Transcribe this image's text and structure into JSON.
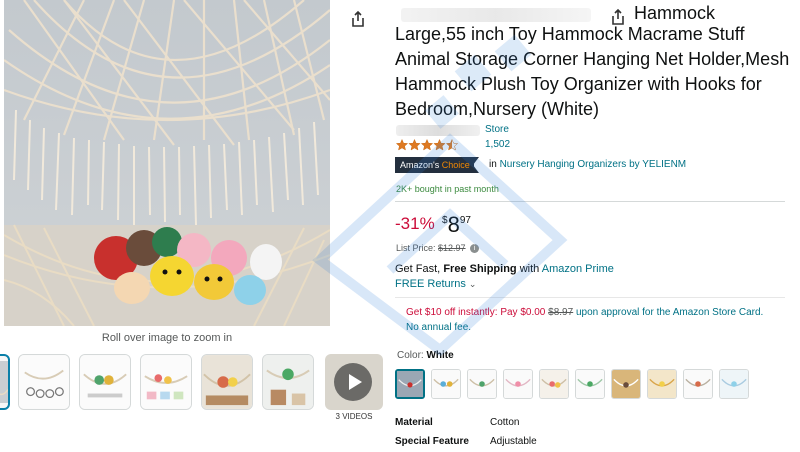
{
  "product": {
    "title_fragment_top": "Hammock",
    "title": "Large,55 inch Toy Hammock Macrame Stuff Animal Storage Corner Hanging Net Holder,Mesh Hammock Plush Toy Organizer with Hooks for Bedroom,Nursery (White)",
    "store_link": "Store",
    "rating_count": "1,502",
    "badge_prefix": "Amazon's",
    "badge_accent": "Choice",
    "badge_in": "in",
    "badge_category": "Nursery Hanging Organizers by YELIENM",
    "bought_past_month": "2K+ bought in past month"
  },
  "pricing": {
    "discount": "-31%",
    "currency": "$",
    "price_whole": "8",
    "price_fraction": "97",
    "list_price_label": "List Price:",
    "list_price_value": "$12.97",
    "info_icon": "i"
  },
  "delivery": {
    "shipping_prefix": "Get Fast,",
    "shipping_bold": "Free Shipping",
    "shipping_with": "with",
    "prime_link": "Amazon Prime",
    "returns_label": "FREE Returns",
    "returns_chevron": "⌄"
  },
  "promo": {
    "part1": "Get $10 off instantly: Pay",
    "pay_amount": "$0.00",
    "strike_amount": "$8.97",
    "part2": "upon approval for the Amazon Store Card. No annual fee."
  },
  "gallery": {
    "zoom_hint": "Roll over image to zoom in",
    "videos_label": "3 VIDEOS"
  },
  "color": {
    "label": "Color:",
    "selected": "White"
  },
  "specs": [
    {
      "key": "Material",
      "value": "Cotton"
    },
    {
      "key": "Special Feature",
      "value": "Adjustable"
    }
  ],
  "colors": {
    "link": "#007185",
    "price_red": "#cc0c39",
    "badge_bg": "#232f3e",
    "badge_accent": "#f08804",
    "bought_green": "#3b8a3e",
    "star": "#de7921"
  },
  "icons": {
    "share": "share-icon",
    "play": "play-icon",
    "star": "star-icon"
  },
  "rating": {
    "value": 4.5,
    "max": 5
  }
}
